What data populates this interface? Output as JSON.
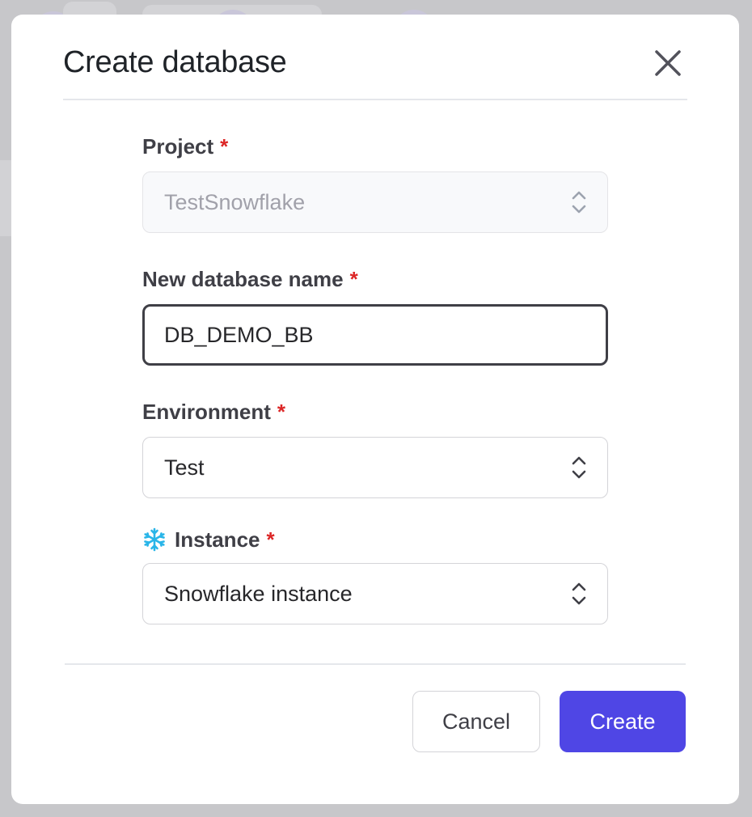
{
  "dialog": {
    "title": "Create database"
  },
  "fields": {
    "project": {
      "label": "Project",
      "required_mark": "*",
      "value": "TestSnowflake"
    },
    "database_name": {
      "label": "New database name",
      "required_mark": "*",
      "value": "DB_DEMO_BB"
    },
    "environment": {
      "label": "Environment",
      "required_mark": "*",
      "value": "Test"
    },
    "instance": {
      "label": "Instance",
      "required_mark": "*",
      "value": "Snowflake instance",
      "icon": "snowflake-icon"
    }
  },
  "footer": {
    "cancel_label": "Cancel",
    "create_label": "Create"
  },
  "colors": {
    "primary": "#4f46e5",
    "required": "#dc2626",
    "snowflake": "#29b5e8"
  }
}
